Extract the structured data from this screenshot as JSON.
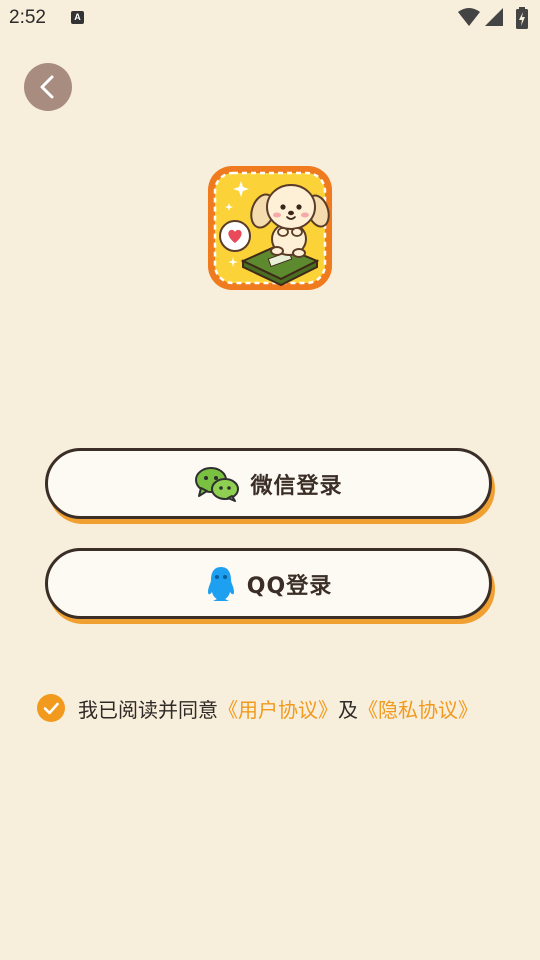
{
  "status_bar": {
    "time": "2:52",
    "app_icon_letter": "A",
    "icons": [
      "wifi-icon",
      "cellular-signal-icon",
      "battery-charging-icon"
    ]
  },
  "header": {
    "back_icon": "chevron-left-icon"
  },
  "login": {
    "wechat_label": "微信登录",
    "qq_label": "QQ登录"
  },
  "agreement": {
    "prefix": "我已阅读并同意",
    "user_agreement": "《用户协议》",
    "conjunction": "及",
    "privacy_policy": "《隐私协议》",
    "checked": true
  },
  "colors": {
    "background": "#f7eedb",
    "accent": "#f29a1e",
    "button_border": "#3a2e26",
    "back_button": "#a88c7f",
    "wechat_green": "#7ac142",
    "qq_blue": "#1ea0f0"
  }
}
